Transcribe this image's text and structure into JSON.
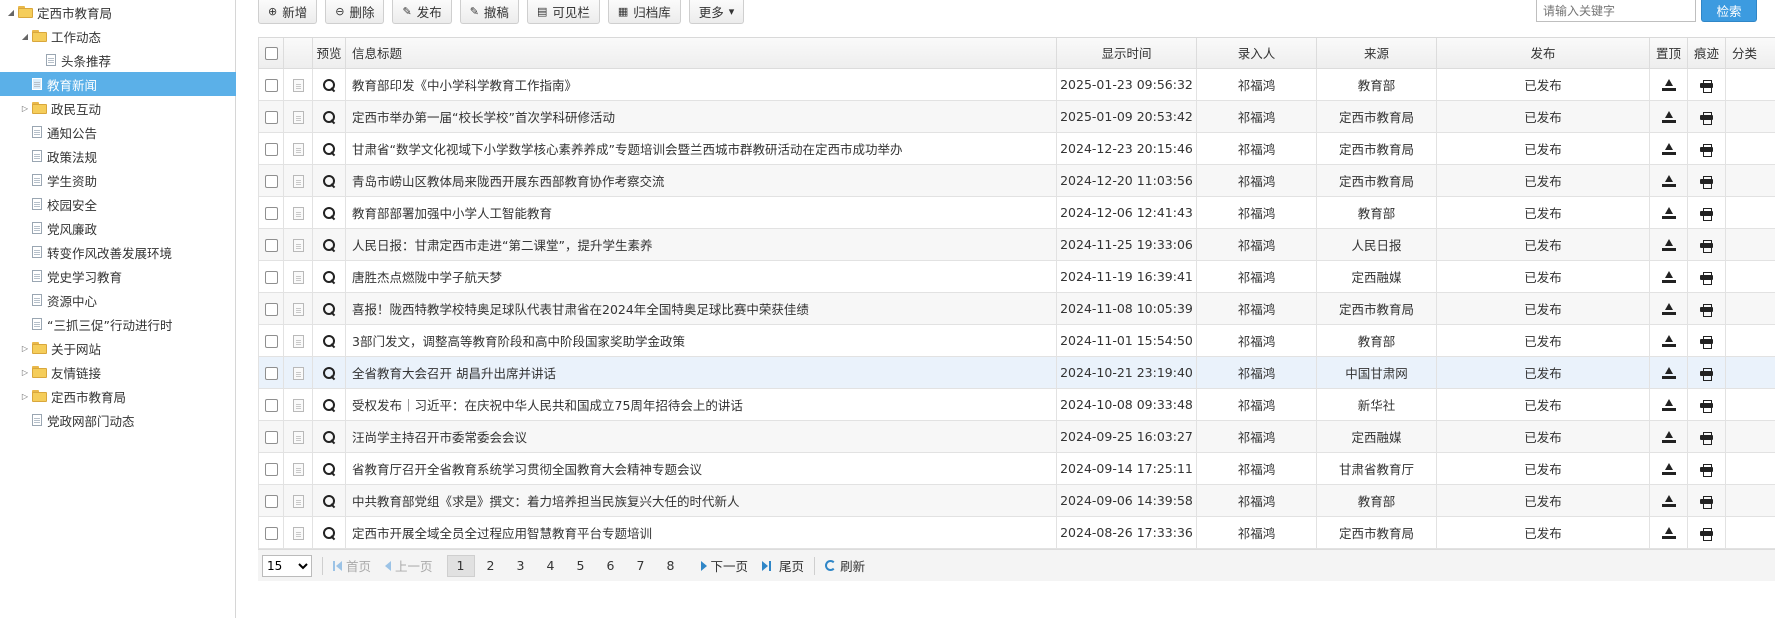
{
  "sidebar": {
    "items": [
      {
        "label": "定西市教育局",
        "type": "folder",
        "toggle": "◢",
        "level": 0,
        "selected": false
      },
      {
        "label": "工作动态",
        "type": "folder",
        "toggle": "◢",
        "level": 1,
        "selected": false
      },
      {
        "label": "头条推荐",
        "type": "page",
        "toggle": "",
        "level": 2,
        "selected": false
      },
      {
        "label": "教育新闻",
        "type": "page",
        "toggle": "",
        "level": 1,
        "selected": true
      },
      {
        "label": "政民互动",
        "type": "folder",
        "toggle": "▷",
        "level": 1,
        "selected": false
      },
      {
        "label": "通知公告",
        "type": "page",
        "toggle": "",
        "level": 1,
        "selected": false
      },
      {
        "label": "政策法规",
        "type": "page",
        "toggle": "",
        "level": 1,
        "selected": false
      },
      {
        "label": "学生资助",
        "type": "page",
        "toggle": "",
        "level": 1,
        "selected": false
      },
      {
        "label": "校园安全",
        "type": "page",
        "toggle": "",
        "level": 1,
        "selected": false
      },
      {
        "label": "党风廉政",
        "type": "page",
        "toggle": "",
        "level": 1,
        "selected": false
      },
      {
        "label": "转变作风改善发展环境",
        "type": "page",
        "toggle": "",
        "level": 1,
        "selected": false
      },
      {
        "label": "党史学习教育",
        "type": "page",
        "toggle": "",
        "level": 1,
        "selected": false
      },
      {
        "label": "资源中心",
        "type": "page",
        "toggle": "",
        "level": 1,
        "selected": false
      },
      {
        "label": "“三抓三促”行动进行时",
        "type": "page",
        "toggle": "",
        "level": 1,
        "selected": false
      },
      {
        "label": "关于网站",
        "type": "folder",
        "toggle": "▷",
        "level": 1,
        "selected": false
      },
      {
        "label": "友情链接",
        "type": "folder",
        "toggle": "▷",
        "level": 1,
        "selected": false
      },
      {
        "label": "定西市教育局",
        "type": "folder",
        "toggle": "▷",
        "level": 1,
        "selected": false
      },
      {
        "label": "党政网部门动态",
        "type": "page",
        "toggle": "",
        "level": 1,
        "selected": false
      }
    ]
  },
  "toolbar": {
    "buttons": [
      {
        "label": "新增",
        "icon": "add-icon",
        "glyph": "⊕"
      },
      {
        "label": "删除",
        "icon": "delete-icon",
        "glyph": "⊖"
      },
      {
        "label": "发布",
        "icon": "publish-icon",
        "glyph": "✎"
      },
      {
        "label": "撤稿",
        "icon": "withdraw-icon",
        "glyph": "✎"
      },
      {
        "label": "可见栏",
        "icon": "columns-icon",
        "glyph": "▤"
      },
      {
        "label": "归档库",
        "icon": "archive-icon",
        "glyph": "▦"
      },
      {
        "label": "更多",
        "icon": "chevron-down-icon",
        "glyph": "▾"
      }
    ],
    "search_placeholder": "请输入关键字",
    "search_label": "检索"
  },
  "grid": {
    "headers": {
      "preview": "预览",
      "title": "信息标题",
      "time": "显示时间",
      "author": "录入人",
      "source": "来源",
      "publish": "发布",
      "top": "置顶",
      "trace": "痕迹",
      "category": "分类"
    },
    "rows": [
      {
        "title": "教育部印发《中小学科学教育工作指南》",
        "time": "2025-01-23 09:56:32",
        "author": "祁福鸿",
        "source": "教育部",
        "status": "已发布"
      },
      {
        "title": "定西市举办第一届“校长学校”首次学科研修活动",
        "time": "2025-01-09 20:53:42",
        "author": "祁福鸿",
        "source": "定西市教育局",
        "status": "已发布"
      },
      {
        "title": "甘肃省“数学文化视域下小学数学核心素养养成”专题培训会暨兰西城市群教研活动在定西市成功举办",
        "time": "2024-12-23 20:15:46",
        "author": "祁福鸿",
        "source": "定西市教育局",
        "status": "已发布"
      },
      {
        "title": "青岛市崂山区教体局来陇西开展东西部教育协作考察交流",
        "time": "2024-12-20 11:03:56",
        "author": "祁福鸿",
        "source": "定西市教育局",
        "status": "已发布"
      },
      {
        "title": "教育部部署加强中小学人工智能教育",
        "time": "2024-12-06 12:41:43",
        "author": "祁福鸿",
        "source": "教育部",
        "status": "已发布"
      },
      {
        "title": "人民日报：甘肃定西市走进“第二课堂”，提升学生素养",
        "time": "2024-11-25 19:33:06",
        "author": "祁福鸿",
        "source": "人民日报",
        "status": "已发布"
      },
      {
        "title": "唐胜杰点燃陇中学子航天梦",
        "time": "2024-11-19 16:39:41",
        "author": "祁福鸿",
        "source": "定西融媒",
        "status": "已发布"
      },
      {
        "title": "喜报！陇西特教学校特奥足球队代表甘肃省在2024年全国特奥足球比赛中荣获佳绩",
        "time": "2024-11-08 10:05:39",
        "author": "祁福鸿",
        "source": "定西市教育局",
        "status": "已发布"
      },
      {
        "title": "3部门发文，调整高等教育阶段和高中阶段国家奖助学金政策",
        "time": "2024-11-01 15:54:50",
        "author": "祁福鸿",
        "source": "教育部",
        "status": "已发布"
      },
      {
        "title": "全省教育大会召开 胡昌升出席并讲话",
        "time": "2024-10-21 23:19:40",
        "author": "祁福鸿",
        "source": "中国甘肃网",
        "status": "已发布"
      },
      {
        "title": "受权发布｜习近平：在庆祝中华人民共和国成立75周年招待会上的讲话",
        "time": "2024-10-08 09:33:48",
        "author": "祁福鸿",
        "source": "新华社",
        "status": "已发布"
      },
      {
        "title": "汪尚学主持召开市委常委会会议",
        "time": "2024-09-25 16:03:27",
        "author": "祁福鸿",
        "source": "定西融媒",
        "status": "已发布"
      },
      {
        "title": "省教育厅召开全省教育系统学习贯彻全国教育大会精神专题会议",
        "time": "2024-09-14 17:25:11",
        "author": "祁福鸿",
        "source": "甘肃省教育厅",
        "status": "已发布"
      },
      {
        "title": "中共教育部党组《求是》撰文：着力培养担当民族复兴大任的时代新人",
        "time": "2024-09-06 14:39:58",
        "author": "祁福鸿",
        "source": "教育部",
        "status": "已发布"
      },
      {
        "title": "定西市开展全域全员全过程应用智慧教育平台专题培训",
        "time": "2024-08-26 17:33:36",
        "author": "祁福鸿",
        "source": "定西市教育局",
        "status": "已发布"
      }
    ],
    "hover_row": 9
  },
  "pager": {
    "page_size": "15",
    "first": "首页",
    "prev": "上一页",
    "pages": [
      "1",
      "2",
      "3",
      "4",
      "5",
      "6",
      "7",
      "8"
    ],
    "current": "1",
    "next": "下一页",
    "last": "尾页",
    "refresh": "刷新"
  },
  "colors": {
    "selected_bg": "#5bb0e8",
    "published": "#2ea02e",
    "search_button": "#3c9be0"
  }
}
